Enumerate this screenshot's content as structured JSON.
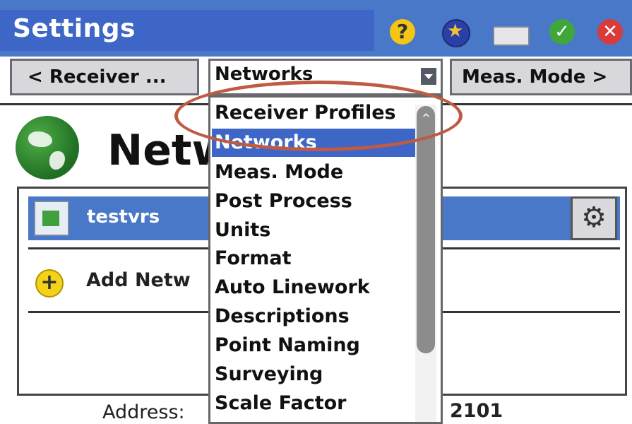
{
  "window": {
    "title": "Settings"
  },
  "title_icons": {
    "help": "?",
    "favorites": "star-icon",
    "keyboard": "keyboard-icon",
    "ok": "✓",
    "close": "✕"
  },
  "nav": {
    "prev_label": "< Receiver ...",
    "selected": "Networks",
    "next_label": "Meas. Mode >"
  },
  "page": {
    "title": "Netw"
  },
  "list": {
    "items": [
      {
        "label": "testvrs",
        "selected": true
      }
    ],
    "add_label": "Add Netw"
  },
  "address": {
    "label": "Address:",
    "value": "2101"
  },
  "dropdown": {
    "items": [
      "Receiver Profiles",
      "Networks",
      "Meas. Mode",
      "Post Process",
      "Units",
      "Format",
      "Auto Linework",
      "Descriptions",
      "Point Naming",
      "Surveying",
      "Scale Factor"
    ],
    "selected_index": 1
  },
  "colors": {
    "title_bar": "#4a78c8",
    "selection": "#3d66c7",
    "highlight": "#c05b43"
  }
}
